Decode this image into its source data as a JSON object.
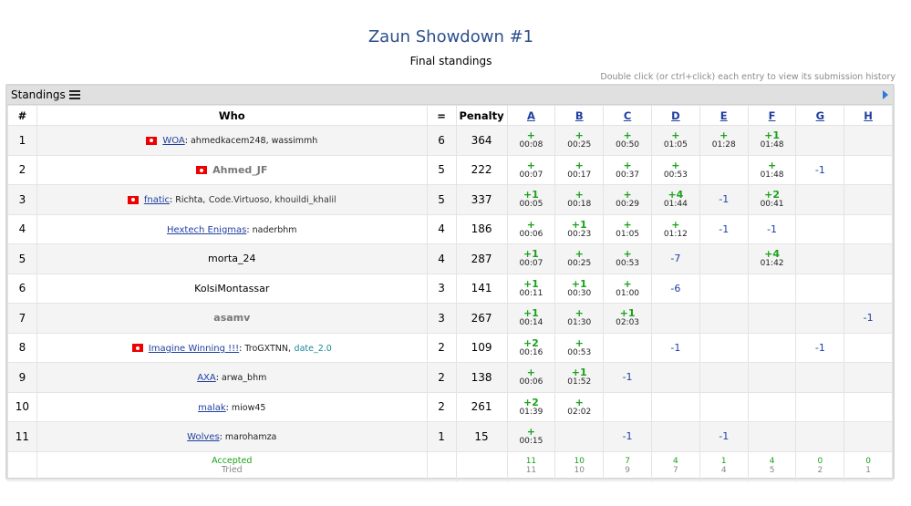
{
  "contest_title": "Zaun Showdown #1",
  "subtitle": "Final standings",
  "hint": "Double click (or ctrl+click) each entry to view its submission history",
  "panel": {
    "title": "Standings"
  },
  "columns": {
    "rank": "#",
    "who": "Who",
    "solved": "=",
    "penalty": "Penalty"
  },
  "problems": [
    "A",
    "B",
    "C",
    "D",
    "E",
    "F",
    "G",
    "H"
  ],
  "rows": [
    {
      "rank": "1",
      "flag": true,
      "team": "WOA",
      "members": "ahmedkacem248, wassimmh",
      "solved": "6",
      "penalty": "364",
      "cells": [
        {
          "a": "+",
          "t": "00:08"
        },
        {
          "a": "+",
          "t": "00:25"
        },
        {
          "a": "+",
          "t": "00:50"
        },
        {
          "a": "+",
          "t": "01:05"
        },
        {
          "a": "+",
          "t": "01:28"
        },
        {
          "a": "+1",
          "t": "01:48"
        },
        null,
        null
      ]
    },
    {
      "rank": "2",
      "flag": true,
      "handle_gray": "Ahmed_JF",
      "solved": "5",
      "penalty": "222",
      "cells": [
        {
          "a": "+",
          "t": "00:07"
        },
        {
          "a": "+",
          "t": "00:17"
        },
        {
          "a": "+",
          "t": "00:37"
        },
        {
          "a": "+",
          "t": "00:53"
        },
        null,
        {
          "a": "+",
          "t": "01:48"
        },
        {
          "r": "-1"
        },
        null
      ]
    },
    {
      "rank": "3",
      "flag": true,
      "team": "fnatic",
      "members": "Richta,",
      "members_gray": "Code.Virtuoso, khouildi_khalil",
      "solved": "5",
      "penalty": "337",
      "cells": [
        {
          "a": "+1",
          "t": "00:05"
        },
        {
          "a": "+",
          "t": "00:18"
        },
        {
          "a": "+",
          "t": "00:29"
        },
        {
          "a": "+4",
          "t": "01:44"
        },
        {
          "r": "-1"
        },
        {
          "a": "+2",
          "t": "00:41"
        },
        null,
        null
      ]
    },
    {
      "rank": "4",
      "team": "Hextech Enigmas",
      "members": "naderbhm",
      "solved": "4",
      "penalty": "186",
      "cells": [
        {
          "a": "+",
          "t": "00:06"
        },
        {
          "a": "+1",
          "t": "00:23"
        },
        {
          "a": "+",
          "t": "01:05"
        },
        {
          "a": "+",
          "t": "01:12"
        },
        {
          "r": "-1"
        },
        {
          "r": "-1"
        },
        null,
        null
      ]
    },
    {
      "rank": "5",
      "handle": "morta_24",
      "solved": "4",
      "penalty": "287",
      "cells": [
        {
          "a": "+1",
          "t": "00:07"
        },
        {
          "a": "+",
          "t": "00:25"
        },
        {
          "a": "+",
          "t": "00:53"
        },
        {
          "r": "-7"
        },
        null,
        {
          "a": "+4",
          "t": "01:42"
        },
        null,
        null
      ]
    },
    {
      "rank": "6",
      "handle": "KolsiMontassar",
      "solved": "3",
      "penalty": "141",
      "cells": [
        {
          "a": "+1",
          "t": "00:11"
        },
        {
          "a": "+1",
          "t": "00:30"
        },
        {
          "a": "+",
          "t": "01:00"
        },
        {
          "r": "-6"
        },
        null,
        null,
        null,
        null
      ]
    },
    {
      "rank": "7",
      "handle_gray": "asamv",
      "solved": "3",
      "penalty": "267",
      "cells": [
        {
          "a": "+1",
          "t": "00:14"
        },
        {
          "a": "+",
          "t": "01:30"
        },
        {
          "a": "+1",
          "t": "02:03"
        },
        null,
        null,
        null,
        null,
        {
          "r": "-1"
        }
      ]
    },
    {
      "rank": "8",
      "flag": true,
      "team": "Imagine Winning !!!",
      "members": "TroGXTNN,",
      "members_blue": "date_2.0",
      "solved": "2",
      "penalty": "109",
      "cells": [
        {
          "a": "+2",
          "t": "00:16"
        },
        {
          "a": "+",
          "t": "00:53"
        },
        null,
        {
          "r": "-1"
        },
        null,
        null,
        {
          "r": "-1"
        },
        null
      ]
    },
    {
      "rank": "9",
      "team": "AXA",
      "members": "arwa_bhm",
      "solved": "2",
      "penalty": "138",
      "cells": [
        {
          "a": "+",
          "t": "00:06"
        },
        {
          "a": "+1",
          "t": "01:52"
        },
        {
          "r": "-1"
        },
        null,
        null,
        null,
        null,
        null
      ]
    },
    {
      "rank": "10",
      "team": "malak",
      "members": "miow45",
      "solved": "2",
      "penalty": "261",
      "cells": [
        {
          "a": "+2",
          "t": "01:39"
        },
        {
          "a": "+",
          "t": "02:02"
        },
        null,
        null,
        null,
        null,
        null,
        null
      ]
    },
    {
      "rank": "11",
      "team": "Wolves",
      "members": "marohamza",
      "solved": "1",
      "penalty": "15",
      "cells": [
        {
          "a": "+",
          "t": "00:15"
        },
        null,
        {
          "r": "-1"
        },
        null,
        {
          "r": "-1"
        },
        null,
        null,
        null
      ]
    }
  ],
  "footer": {
    "accepted_label": "Accepted",
    "tried_label": "Tried",
    "accepted": [
      "11",
      "10",
      "7",
      "4",
      "1",
      "4",
      "0",
      "0"
    ],
    "tried": [
      "11",
      "10",
      "9",
      "7",
      "4",
      "5",
      "2",
      "1"
    ]
  },
  "colors": {
    "accepted": "#1aa31a",
    "rejected": "#1f3fa0",
    "title": "#2c4f8c",
    "row_alt": "#f4f4f4"
  }
}
